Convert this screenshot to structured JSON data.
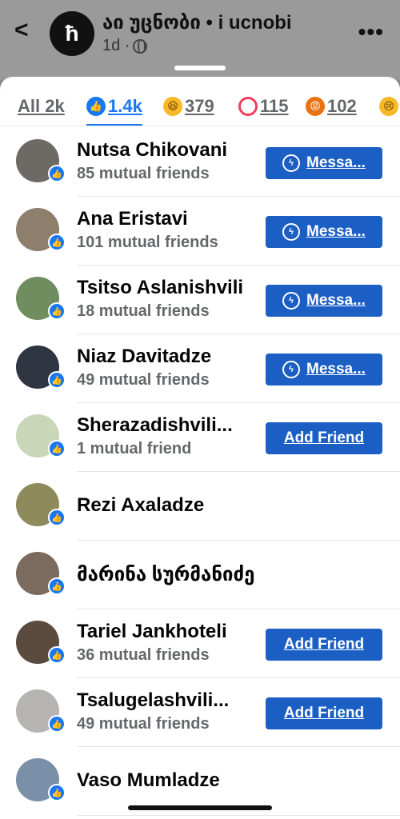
{
  "header": {
    "title": "აი უცნობი • i ucnobi",
    "meta_age": "1d ·",
    "avatar_glyph": "ħ"
  },
  "tabs": [
    {
      "label": "All 2k",
      "icon": null
    },
    {
      "label": "1.4k",
      "icon": "like-icon"
    },
    {
      "label": "379",
      "icon": "haha-icon"
    },
    {
      "label": "115",
      "icon": "love-icon"
    },
    {
      "label": "102",
      "icon": "angry-icon"
    },
    {
      "label": "",
      "icon": "sad-icon"
    }
  ],
  "people": [
    {
      "name": "Nutsa Chikovani",
      "mutual": "85 mutual friends",
      "action": "Messa...",
      "action_type": "message",
      "avatar_color": "#6d6a66"
    },
    {
      "name": "Ana Eristavi",
      "mutual": "101 mutual friends",
      "action": "Messa...",
      "action_type": "message",
      "avatar_color": "#8d7f6b"
    },
    {
      "name": "Tsitso Aslanishvili",
      "mutual": "18 mutual friends",
      "action": "Messa...",
      "action_type": "message",
      "avatar_color": "#6f8d5e"
    },
    {
      "name": "Niaz Davitadze",
      "mutual": "49 mutual friends",
      "action": "Messa...",
      "action_type": "message",
      "avatar_color": "#2f3541"
    },
    {
      "name": "Sherazadishvili...",
      "mutual": "1 mutual friend",
      "action": "Add Friend",
      "action_type": "add",
      "avatar_color": "#c9d6b8"
    },
    {
      "name": "Rezi Axaladze",
      "mutual": "",
      "action": "",
      "action_type": "none",
      "avatar_color": "#8e8a5c"
    },
    {
      "name": "მარინა სურმანიძე",
      "mutual": "",
      "action": "",
      "action_type": "none",
      "avatar_color": "#7b6a5e"
    },
    {
      "name": "Tariel Jankhoteli",
      "mutual": "36 mutual friends",
      "action": "Add Friend",
      "action_type": "add",
      "avatar_color": "#5b4a3e"
    },
    {
      "name": "Tsalugelashvili...",
      "mutual": "49 mutual friends",
      "action": "Add Friend",
      "action_type": "add",
      "avatar_color": "#b6b4b2"
    },
    {
      "name": "Vaso Mumladze",
      "mutual": "",
      "action": "",
      "action_type": "none",
      "avatar_color": "#7a8fa8"
    }
  ],
  "colors": {
    "accent": "#1877f2",
    "button": "#1b5fc4"
  }
}
